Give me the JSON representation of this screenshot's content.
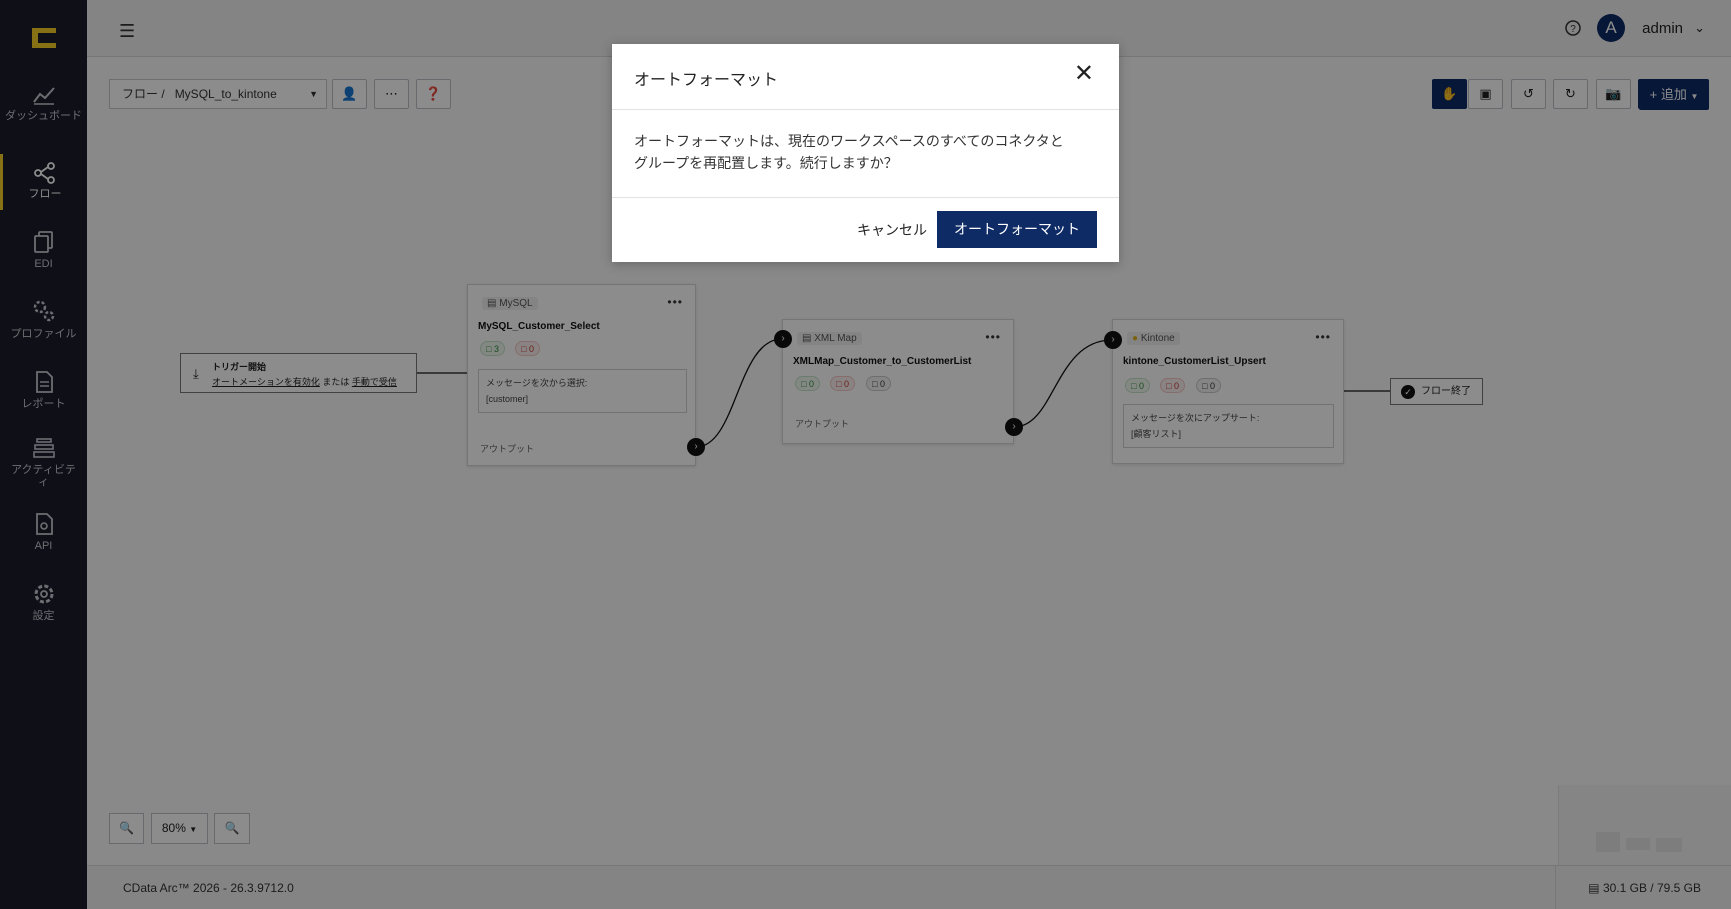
{
  "sidebar": {
    "items": [
      {
        "label": "ダッシュボード",
        "icon": "chart-line-icon"
      },
      {
        "label": "フロー",
        "icon": "share-nodes-icon",
        "active": true
      },
      {
        "label": "EDI",
        "icon": "documents-icon"
      },
      {
        "label": "プロファイル",
        "icon": "gears-icon"
      },
      {
        "label": "レポート",
        "icon": "report-icon"
      },
      {
        "label": "アクティビティ",
        "icon": "layers-icon"
      },
      {
        "label": "API",
        "icon": "api-doc-icon"
      },
      {
        "label": "設定",
        "icon": "settings-gear-icon"
      }
    ],
    "accent_color": "#f4cf27"
  },
  "header": {
    "avatar_letter": "A",
    "user_name": "admin"
  },
  "toolbar": {
    "breadcrumb_prefix": "フロー /",
    "breadcrumb_flow": "MySQL_to_kintone",
    "add_label": "+ 追加"
  },
  "flow": {
    "trigger": {
      "title": "トリガー開始",
      "link1": "オートメーションを有効化",
      "middle": "または",
      "link2": "手動で受信"
    },
    "nodes": [
      {
        "type": "MySQL",
        "name": "MySQL_Customer_Select",
        "badges": [
          "3",
          "0"
        ],
        "message_label": "メッセージを次から選択:",
        "message_value": "[customer]",
        "output_label": "アウトプット"
      },
      {
        "type": "XML Map",
        "name": "XMLMap_Customer_to_CustomerList",
        "badges": [
          "0",
          "0",
          "0"
        ],
        "output_label": "アウトプット"
      },
      {
        "type": "Kintone",
        "name": "kintone_CustomerList_Upsert",
        "badges": [
          "0",
          "0",
          "0"
        ],
        "message_label": "メッセージを次にアップサート:",
        "message_value": "[顧客リスト]"
      }
    ],
    "end_label": "フロー終了"
  },
  "zoom": {
    "level": "80%"
  },
  "footer": {
    "version": "CData Arc™ 2026 - 26.3.9712.0",
    "storage": "30.1 GB / 79.5 GB"
  },
  "modal": {
    "title": "オートフォーマット",
    "body_line1": "オートフォーマットは、現在のワークスペースのすべてのコネクタと",
    "body_line2": "グループを再配置します。続行しますか？",
    "cancel_label": "キャンセル",
    "confirm_label": "オートフォーマット"
  },
  "colors": {
    "primary": "#0e2b66",
    "sidebar_bg": "#1b1d2a"
  }
}
